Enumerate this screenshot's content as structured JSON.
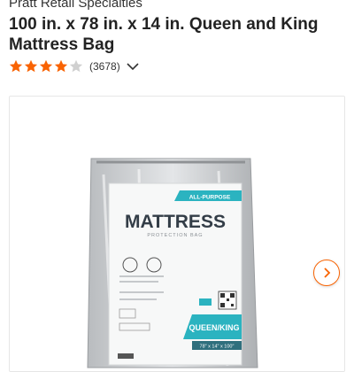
{
  "product": {
    "brand": "Pratt Retail Specialties",
    "title": "100 in. x 78 in. x 14 in. Queen and King Mattress Bag",
    "rating": 4,
    "rating_max": 5,
    "review_count": "(3678)"
  },
  "package": {
    "badge": "ALL-PURPOSE",
    "heading": "MATTRESS",
    "subheading": "PROTECTION BAG",
    "size_label": "QUEEN/KING",
    "dimensions": "78\" x 14\" x 100\""
  },
  "colors": {
    "star": "#f96302",
    "teal": "#2bb3c0",
    "accent": "#f96302"
  },
  "icons": {
    "rating_dropdown": "chevron-down-icon",
    "gallery_next": "chevron-right-icon"
  }
}
